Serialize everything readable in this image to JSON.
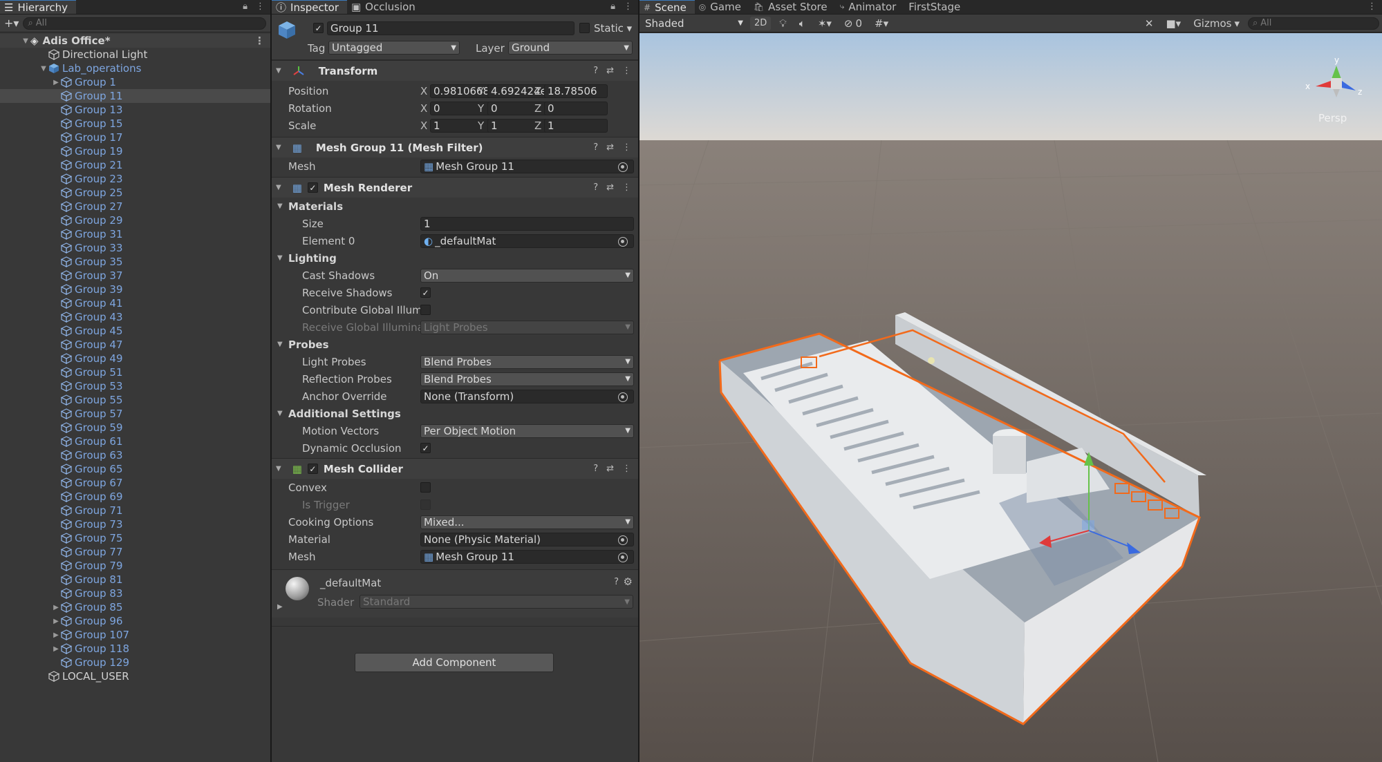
{
  "hierarchy": {
    "tab_label": "Hierarchy",
    "search_placeholder": "All",
    "scene_name": "Adis Office*",
    "directional_light": "Directional Light",
    "lab_ops": "Lab_operations",
    "groups": [
      "Group 1",
      "Group 11",
      "Group 13",
      "Group 15",
      "Group 17",
      "Group 19",
      "Group 21",
      "Group 23",
      "Group 25",
      "Group 27",
      "Group 29",
      "Group 31",
      "Group 33",
      "Group 35",
      "Group 37",
      "Group 39",
      "Group 41",
      "Group 43",
      "Group 45",
      "Group 47",
      "Group 49",
      "Group 51",
      "Group 53",
      "Group 55",
      "Group 57",
      "Group 59",
      "Group 61",
      "Group 63",
      "Group 65",
      "Group 67",
      "Group 69",
      "Group 71",
      "Group 73",
      "Group 75",
      "Group 77",
      "Group 79",
      "Group 81",
      "Group 83",
      "Group 85",
      "Group 96",
      "Group 107",
      "Group 118",
      "Group 129"
    ],
    "expandable_groups": [
      "Group 1",
      "Group 85",
      "Group 96",
      "Group 107",
      "Group 118"
    ],
    "selected_group": "Group 11",
    "local_user": "LOCAL_USER"
  },
  "inspector": {
    "tab_inspector": "Inspector",
    "tab_occlusion": "Occlusion",
    "object_name": "Group 11",
    "static_label": "Static",
    "tag_label": "Tag",
    "tag_value": "Untagged",
    "layer_label": "Layer",
    "layer_value": "Ground",
    "transform": {
      "title": "Transform",
      "position_label": "Position",
      "rotation_label": "Rotation",
      "scale_label": "Scale",
      "position": {
        "x": "0.9810668",
        "y": "4.692424e",
        "z": "18.78506"
      },
      "rotation": {
        "x": "0",
        "y": "0",
        "z": "0"
      },
      "scale": {
        "x": "1",
        "y": "1",
        "z": "1"
      }
    },
    "mesh_filter": {
      "title": "Mesh Group 11 (Mesh Filter)",
      "mesh_label": "Mesh",
      "mesh_value": "Mesh Group 11"
    },
    "mesh_renderer": {
      "title": "Mesh Renderer",
      "materials": "Materials",
      "size_label": "Size",
      "size_value": "1",
      "element0_label": "Element 0",
      "element0_value": "_defaultMat",
      "lighting": "Lighting",
      "cast_shadows_label": "Cast Shadows",
      "cast_shadows_value": "On",
      "receive_shadows_label": "Receive Shadows",
      "contribute_gi_label": "Contribute Global Illumi",
      "receive_gi_label": "Receive Global Illumina",
      "receive_gi_value": "Light Probes",
      "probes": "Probes",
      "light_probes_label": "Light Probes",
      "light_probes_value": "Blend Probes",
      "reflection_probes_label": "Reflection Probes",
      "reflection_probes_value": "Blend Probes",
      "anchor_override_label": "Anchor Override",
      "anchor_override_value": "None (Transform)",
      "additional": "Additional Settings",
      "motion_vectors_label": "Motion Vectors",
      "motion_vectors_value": "Per Object Motion",
      "dynamic_occlusion_label": "Dynamic Occlusion"
    },
    "mesh_collider": {
      "title": "Mesh Collider",
      "convex_label": "Convex",
      "is_trigger_label": "Is Trigger",
      "cooking_label": "Cooking Options",
      "cooking_value": "Mixed...",
      "material_label": "Material",
      "material_value": "None (Physic Material)",
      "mesh_label": "Mesh",
      "mesh_value": "Mesh Group 11"
    },
    "material_block": {
      "name": "_defaultMat",
      "shader_label": "Shader",
      "shader_value": "Standard"
    },
    "add_component": "Add Component"
  },
  "scene": {
    "tabs": [
      "Scene",
      "Game",
      "Asset Store",
      "Animator",
      "FirstStage"
    ],
    "shading": "Shaded",
    "mode_2d": "2D",
    "hidden_count": "0",
    "gizmos": "Gizmos",
    "search_placeholder": "All",
    "persp": "Persp",
    "axis_labels": {
      "x": "x",
      "y": "y",
      "z": "z"
    }
  },
  "colors": {
    "selection_orange": "#f26a1b",
    "link_blue": "#7ea6e0",
    "tab_accent": "#3a79bb"
  }
}
